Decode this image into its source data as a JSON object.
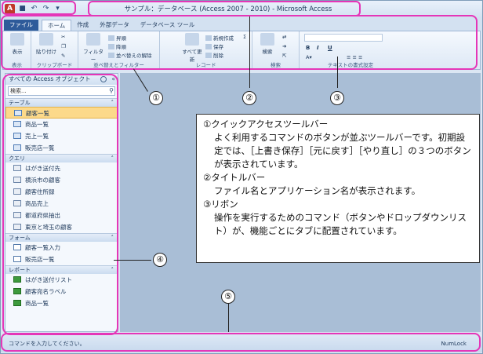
{
  "window": {
    "title": "サンプル：データベース (Access 2007 - 2010) - Microsoft Access",
    "app_icon_letter": "A",
    "qat_icons": [
      "save-icon",
      "undo-icon",
      "redo-icon",
      "customize-qat-icon"
    ]
  },
  "tabs": [
    {
      "label": "ファイル"
    },
    {
      "label": "ホーム"
    },
    {
      "label": "作成"
    },
    {
      "label": "外部データ"
    },
    {
      "label": "データベース ツール"
    }
  ],
  "ribbon": {
    "view": {
      "label": "表示",
      "group": "表示"
    },
    "clipboard": {
      "paste": "貼り付け",
      "group": "クリップボード"
    },
    "sort": {
      "filter": "フィルター",
      "asc": "昇順",
      "desc": "降順",
      "clear": "並べ替えの解除",
      "group": "並べ替えとフィルター"
    },
    "records": {
      "refresh": "すべて更新",
      "new": "新規作成",
      "save": "保存",
      "delete": "削除",
      "sigma": "Σ",
      "group": "レコード"
    },
    "find": {
      "find": "検索",
      "group": "検索"
    },
    "text": {
      "bold": "B",
      "italic": "I",
      "underline": "U",
      "group": "テキストの書式設定"
    }
  },
  "nav": {
    "header": "すべての Access オブジェクト",
    "search_placeholder": "検索...",
    "groups": [
      {
        "name": "テーブル",
        "kind": "table",
        "items": [
          "顧客一覧",
          "商品一覧",
          "売上一覧",
          "販売店一覧"
        ]
      },
      {
        "name": "クエリ",
        "kind": "query",
        "items": [
          "はがき送付先",
          "横浜市の顧客",
          "顧客住所録",
          "商品売上",
          "都道府県抽出",
          "東京と埼玉の顧客"
        ]
      },
      {
        "name": "フォーム",
        "kind": "form",
        "items": [
          "顧客一覧入力",
          "販売店一覧"
        ]
      },
      {
        "name": "レポート",
        "kind": "report",
        "items": [
          "はがき送付リスト",
          "顧客宛名ラベル",
          "商品一覧"
        ]
      }
    ],
    "selected_item": "顧客一覧"
  },
  "status": {
    "text": "コマンドを入力してください。",
    "numlock": "NumLock"
  },
  "callouts": [
    "①",
    "②",
    "③",
    "④",
    "⑤"
  ],
  "explanation": {
    "h1": "①クイックアクセスツールバー",
    "b1": "よく利用するコマンドのボタンが並ぶツールバーです。初期設定では、［上書き保存］［元に戻す］［やり直し］の３つのボタンが表示されています。",
    "h2": "②タイトルバー",
    "b2": "ファイル名とアプリケーション名が表示されます。",
    "h3": "③リボン",
    "b3": "操作を実行するためのコマンド（ボタンやドロップダウンリスト）が、機能ごとにタブに配置されています。"
  },
  "colors": {
    "frame": "#e536b8",
    "file_tab": "#2e5b9a",
    "selected": "#fcd98a"
  }
}
